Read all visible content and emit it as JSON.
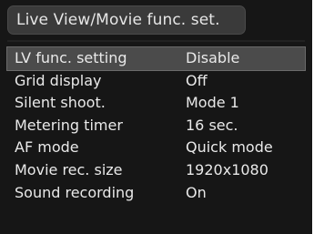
{
  "window": {
    "title": "Live View/Movie func. set."
  },
  "menu": {
    "items": [
      {
        "label": "LV func. setting",
        "value": "Disable",
        "selected": true
      },
      {
        "label": "Grid display",
        "value": "Off"
      },
      {
        "label": "Silent shoot.",
        "value": "Mode 1"
      },
      {
        "label": "Metering timer",
        "value": "16 sec."
      },
      {
        "label": "AF mode",
        "value": "Quick mode"
      },
      {
        "label": "Movie rec. size",
        "value": "1920x1080"
      },
      {
        "label": "Sound recording",
        "value": "On"
      }
    ]
  },
  "colors": {
    "background": "#161616",
    "title_bar": "#3a3a3a",
    "selection": "#4b4b4b",
    "text": "#e9e9e9"
  }
}
